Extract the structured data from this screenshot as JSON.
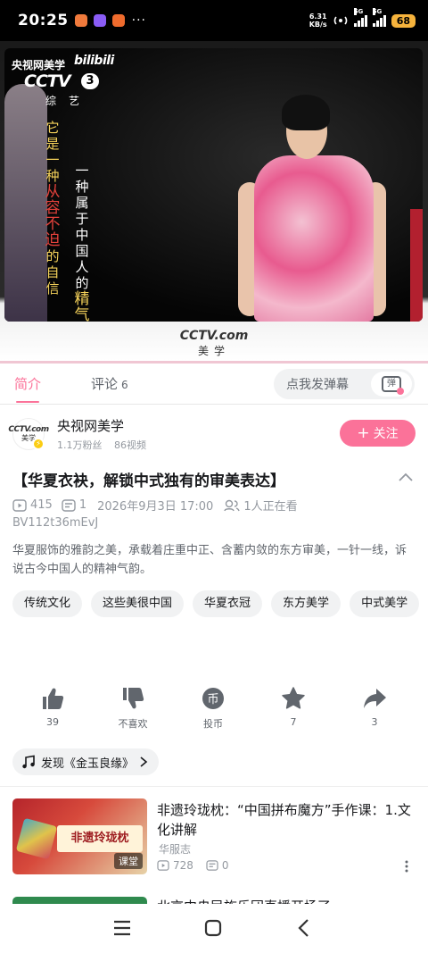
{
  "status_bar": {
    "time": "20:25",
    "more": "···",
    "net_speed": "6.31",
    "net_unit": "KB/s",
    "signal1": "5G",
    "signal2": "5G",
    "battery": "68",
    "app_icon_colors": [
      "#f07a3c",
      "#8a5cf6",
      "#ef6b2d"
    ]
  },
  "video": {
    "watermark_text": "央视网美学",
    "bilibili_logo": "bilibili",
    "cctv_logo": "CCTV",
    "cctv_channel_number": "3",
    "channel_name": "综艺",
    "caption_left": "它是一种从容不迫的自信",
    "caption_left_highlight": "从容不迫",
    "caption_right": "一种属于中国人的精气神",
    "caption_right_highlight": "精气神",
    "bottom_logo": "CCTV.com",
    "bottom_logo_small": "央视网",
    "bottom_logo_sub": "美学"
  },
  "tabs": {
    "intro": "简介",
    "comments": "评论",
    "comments_count": "6",
    "danmaku_placeholder": "点我发弹幕",
    "danmaku_button": "弹"
  },
  "uploader": {
    "name": "央视网美学",
    "avatar_text": "CCTV.com",
    "avatar_sub": "美学",
    "fans": "1.1万粉丝",
    "videos": "86视频",
    "follow_plus": "+",
    "follow_label": "关注"
  },
  "video_info": {
    "title": "【华夏衣袂，解锁中式独有的审美表达】",
    "plays": "415",
    "danmaku": "1",
    "date": "2026年9月3日 17:00",
    "watching": "1人正在看",
    "bvid": "BV112t36mEvJ",
    "description": "华夏服饰的雅韵之美，承载着庄重中正、含蓄内敛的东方审美，一针一线，诉说古今中国人的精神气韵。"
  },
  "tags": [
    "传统文化",
    "这些美很中国",
    "华夏衣冠",
    "东方美学",
    "中式美学"
  ],
  "actions": {
    "like": "39",
    "dislike": "不喜欢",
    "coin": "投币",
    "coin_glyph": "币",
    "favorite": "7",
    "share": "3"
  },
  "music": {
    "label": "发现《金玉良缘》"
  },
  "recommendations": [
    {
      "title": "非遗玲珑枕：“中国拼布魔方”手作课：1.文化讲解",
      "author": "华服志",
      "plays": "728",
      "danmaku": "0",
      "thumb_text": "非遗玲珑枕",
      "badge": "课堂"
    },
    {
      "title": "北京中央民族乐团直播开场了"
    }
  ],
  "colors": {
    "accent": "#fb7299",
    "text_primary": "#18191c",
    "text_secondary": "#9499a0",
    "caption_yellow": "#f5d25a",
    "caption_red": "#e2413b"
  }
}
